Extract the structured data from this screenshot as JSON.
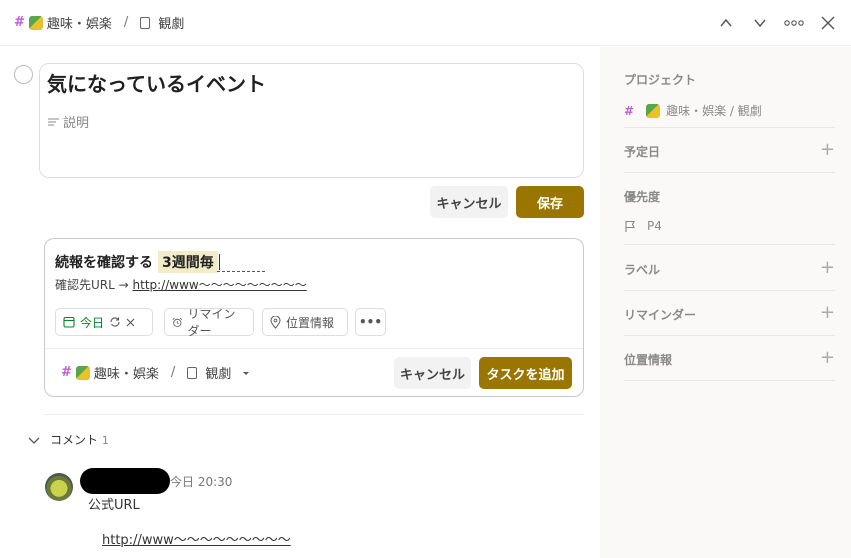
{
  "header": {
    "project": "趣味・娯楽",
    "separator": "/",
    "section": "観劇"
  },
  "task": {
    "title": "気になっているイベント",
    "description_placeholder": "説明",
    "cancel_label": "キャンセル",
    "save_label": "保存"
  },
  "subtask": {
    "title": "続報を確認する",
    "recurrence_highlight": "3週間毎",
    "description_prefix": "確認先URL →",
    "description_link": "http://www～～～～～～～～～",
    "date_chip": "今日",
    "reminder_chip": "リマインダー",
    "location_chip": "位置情報",
    "more_chip": "•••",
    "project": "趣味・娯楽",
    "separator": "/",
    "section": "観劇",
    "cancel_label": "キャンセル",
    "add_label": "タスクを追加"
  },
  "comments": {
    "heading": "コメント",
    "count": "1",
    "items": [
      {
        "time": "今日 20:30",
        "text": "公式URL",
        "link": "http://www～～～～～～～～～"
      }
    ]
  },
  "sidebar": {
    "project_label": "プロジェクト",
    "project_value": "趣味・娯楽 / 観劇",
    "due_label": "予定日",
    "priority_label": "優先度",
    "priority_value": "P4",
    "labels_label": "ラベル",
    "reminder_label": "リマインダー",
    "location_label": "位置情報"
  },
  "colors": {
    "accent": "#9a7600",
    "today": "#058527",
    "hash": "#c05dd8",
    "panel_bg": "#faf9f7"
  }
}
